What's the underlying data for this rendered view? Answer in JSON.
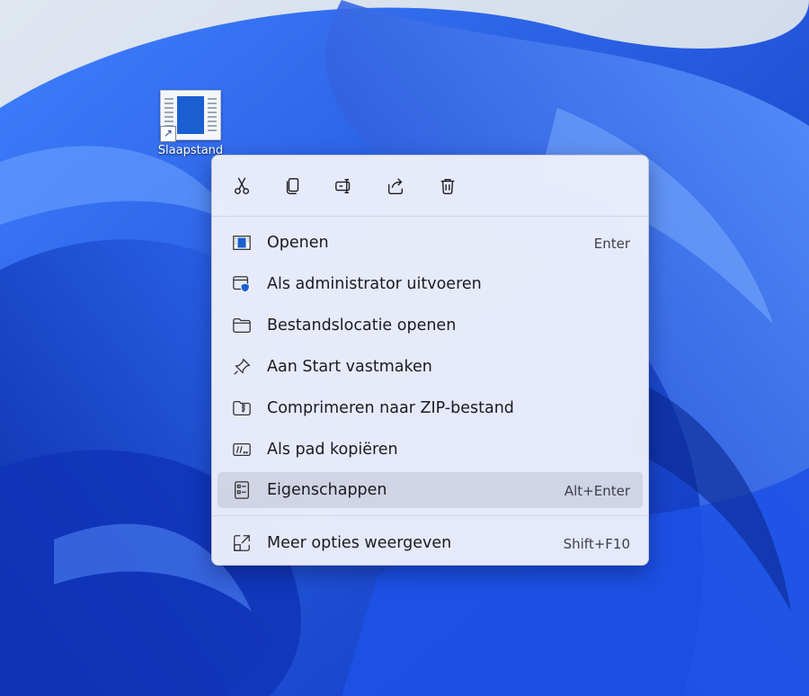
{
  "desktop": {
    "shortcut_label": "Slaapstand",
    "shortcut_icon": "shortcut-arrow-icon"
  },
  "context_menu": {
    "toolbar": [
      {
        "name": "cut",
        "icon": "scissors-icon"
      },
      {
        "name": "copy",
        "icon": "copy-icon"
      },
      {
        "name": "rename",
        "icon": "rename-icon"
      },
      {
        "name": "share",
        "icon": "share-icon"
      },
      {
        "name": "delete",
        "icon": "trash-icon"
      }
    ],
    "items": [
      {
        "label": "Openen",
        "shortcut": "Enter",
        "icon": "window-icon"
      },
      {
        "label": "Als administrator uitvoeren",
        "shortcut": "",
        "icon": "shield-window-icon"
      },
      {
        "label": "Bestandslocatie openen",
        "shortcut": "",
        "icon": "folder-icon"
      },
      {
        "label": "Aan Start vastmaken",
        "shortcut": "",
        "icon": "pin-icon"
      },
      {
        "label": "Comprimeren naar ZIP-bestand",
        "shortcut": "",
        "icon": "zip-folder-icon"
      },
      {
        "label": "Als pad kopiëren",
        "shortcut": "",
        "icon": "copy-path-icon"
      },
      {
        "label": "Eigenschappen",
        "shortcut": "Alt+Enter",
        "icon": "properties-icon"
      }
    ],
    "more_options": {
      "label": "Meer opties weergeven",
      "shortcut": "Shift+F10",
      "icon": "external-open-icon"
    }
  },
  "colors": {
    "accent": "#1a5fd0",
    "menu_bg": "#eceefa",
    "wallpaper": "#1f4fd6"
  }
}
